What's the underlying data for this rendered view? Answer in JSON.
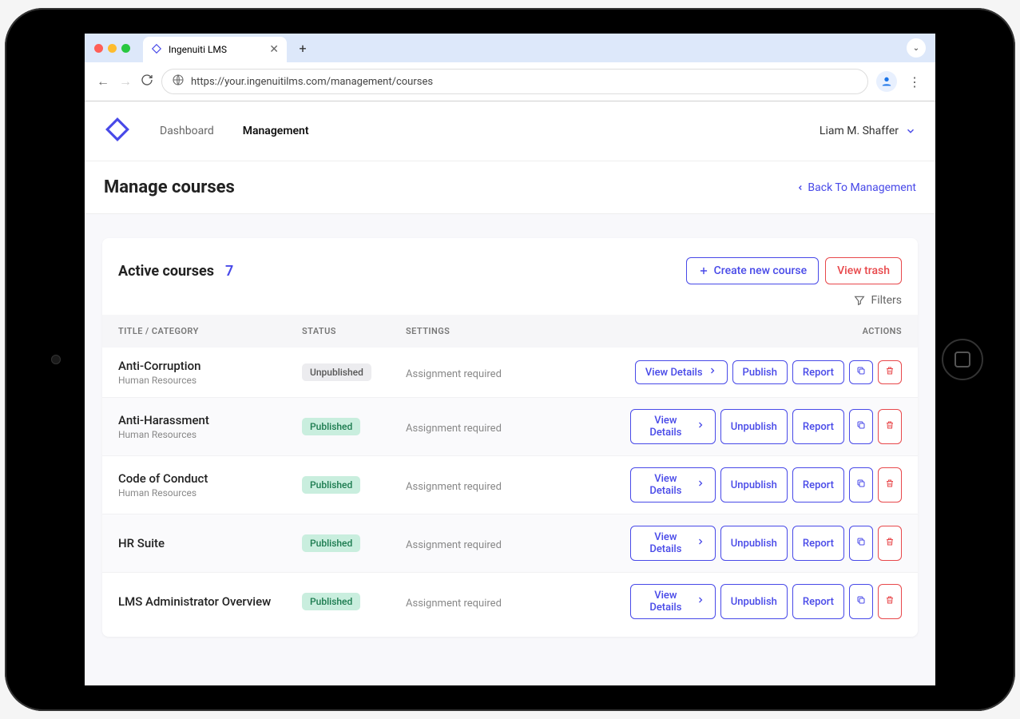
{
  "browser": {
    "tab_title": "Ingenuiti LMS",
    "url": "https://your.ingenuitilms.com/management/courses"
  },
  "header": {
    "nav": {
      "dashboard": "Dashboard",
      "management": "Management"
    },
    "user_name": "Liam M. Shaffer"
  },
  "page": {
    "title": "Manage courses",
    "back_label": "Back To Management"
  },
  "card": {
    "title": "Active courses",
    "count": "7",
    "create_label": "Create new course",
    "trash_label": "View trash",
    "filters_label": "Filters"
  },
  "columns": {
    "title": "TITLE / CATEGORY",
    "status": "STATUS",
    "settings": "SETTINGS",
    "actions": "ACTIONS"
  },
  "action_labels": {
    "view": "View Details",
    "publish": "Publish",
    "unpublish": "Unpublish",
    "report": "Report"
  },
  "status_labels": {
    "published": "Published",
    "unpublished": "Unpublished"
  },
  "rows": [
    {
      "title": "Anti-Corruption",
      "category": "Human Resources",
      "status": "unpublished",
      "settings": "Assignment required"
    },
    {
      "title": "Anti-Harassment",
      "category": "Human Resources",
      "status": "published",
      "settings": "Assignment required"
    },
    {
      "title": "Code of Conduct",
      "category": "Human Resources",
      "status": "published",
      "settings": "Assignment required"
    },
    {
      "title": "HR Suite",
      "category": "",
      "status": "published",
      "settings": "Assignment required"
    },
    {
      "title": "LMS Administrator Overview",
      "category": "",
      "status": "published",
      "settings": "Assignment required"
    }
  ]
}
